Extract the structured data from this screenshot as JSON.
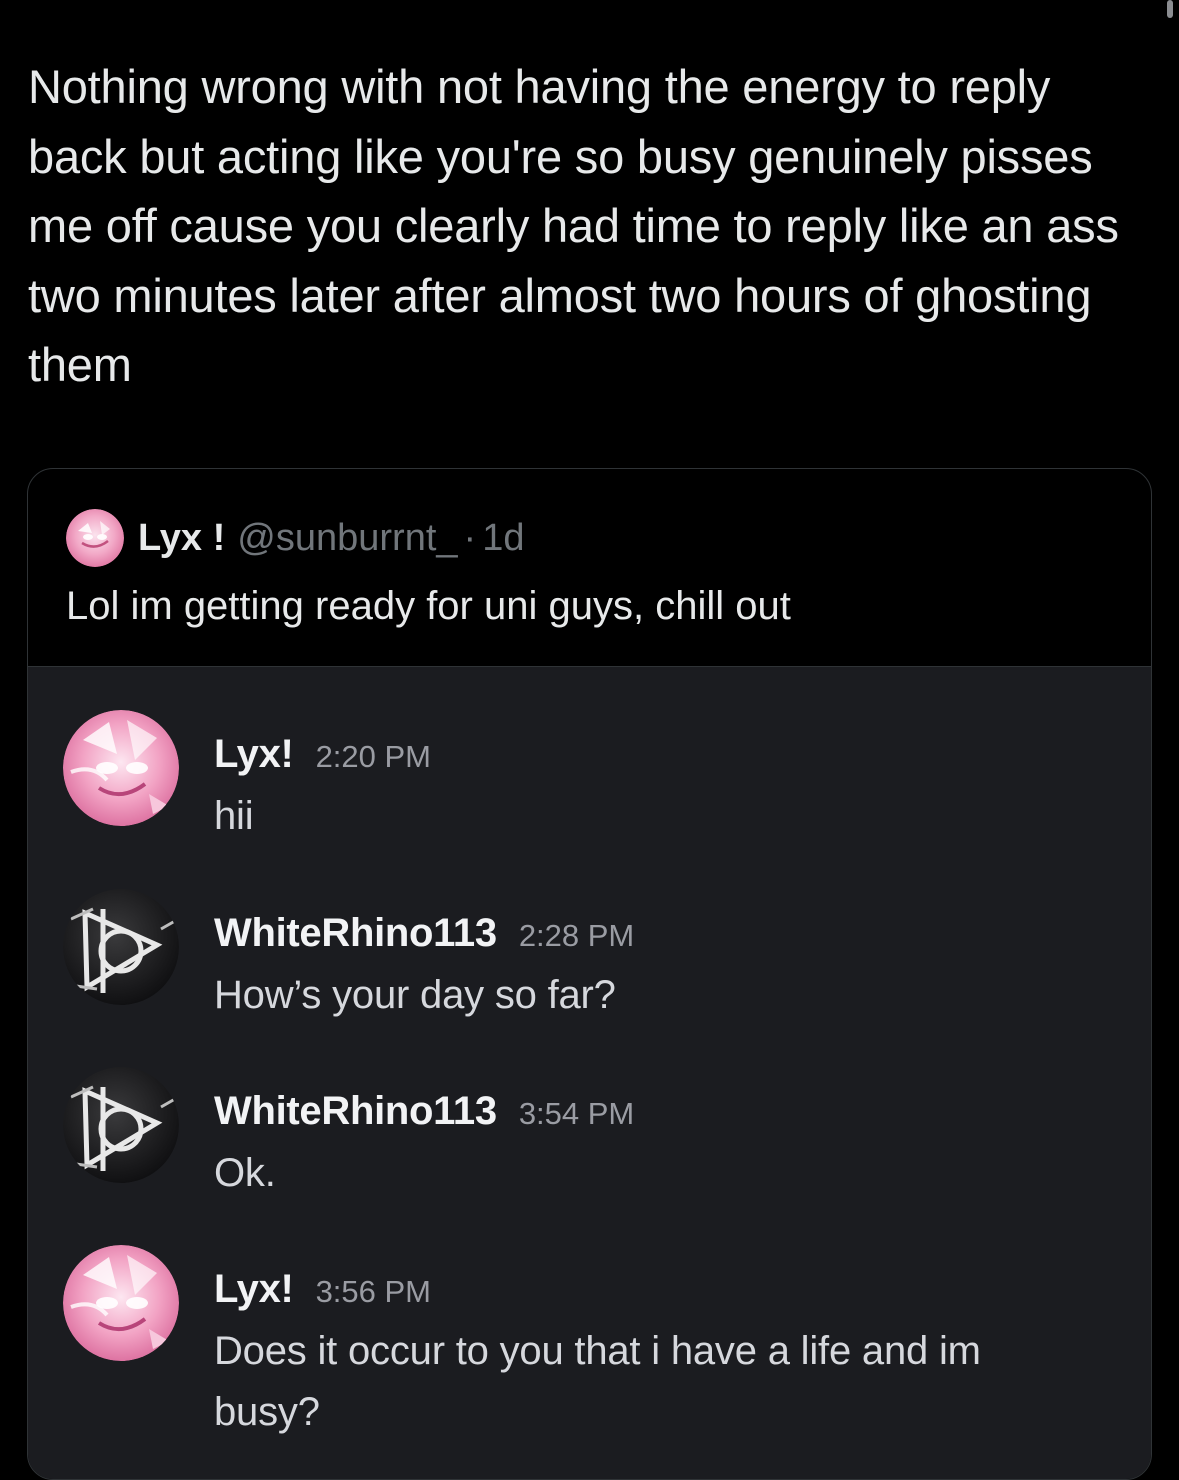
{
  "tweet": {
    "text": "Nothing wrong with not having the energy to reply back but acting like you're so busy genuinely pisses me off cause you clearly had time to reply like an ass two minutes later after almost two hours of ghosting them"
  },
  "quote": {
    "author_name": "Lyx !",
    "author_handle": "@sunburrnt_",
    "separator": "·",
    "time": "1d",
    "text": "Lol im getting ready for uni guys, chill out",
    "avatar_icon": "pink-anime-avatar-icon"
  },
  "chat": {
    "messages": [
      {
        "user": "Lyx!",
        "time": "2:20 PM",
        "text": "hii",
        "avatar_icon": "pink-anime-avatar-icon"
      },
      {
        "user": "WhiteRhino113",
        "time": "2:28 PM",
        "text": "How’s your day so far?",
        "avatar_icon": "deathly-hallows-avatar-icon"
      },
      {
        "user": "WhiteRhino113",
        "time": "3:54 PM",
        "text": "Ok.",
        "avatar_icon": "deathly-hallows-avatar-icon"
      },
      {
        "user": "Lyx!",
        "time": "3:56 PM",
        "text": "Does it occur to you that i have a life and im busy?",
        "avatar_icon": "pink-anime-avatar-icon"
      }
    ]
  },
  "colors": {
    "background": "#000000",
    "primary_text": "#e7e9ea",
    "secondary_text": "#71767b",
    "chat_background": "#1b1c20",
    "card_border": "#2f3336"
  }
}
